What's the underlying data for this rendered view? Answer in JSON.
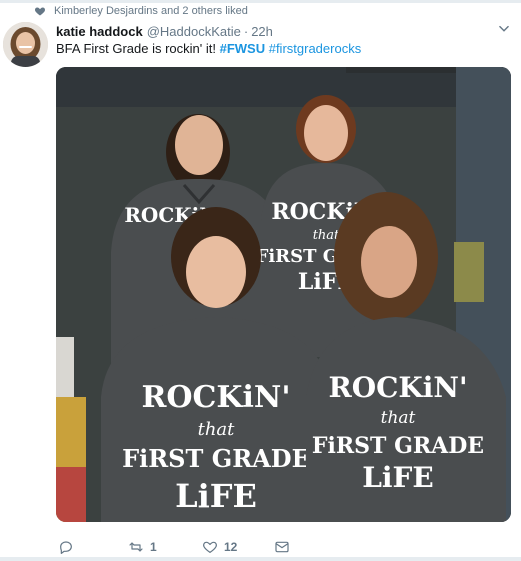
{
  "liked_banner": {
    "text": "Kimberley Desjardins and 2 others liked"
  },
  "tweet": {
    "author_name": "katie haddock",
    "author_handle": "@HaddockKatie",
    "separator": "·",
    "time": "22h",
    "text_plain": "BFA First Grade is rockin' it! ",
    "hashtag_1": "#FWSU",
    "hashtag_2": "#firstgraderocks"
  },
  "photo": {
    "shirt_line_1": "ROCKiN'",
    "shirt_line_2": "that",
    "shirt_line_3": "FiRST GRADE",
    "shirt_line_4": "LiFE"
  },
  "actions": {
    "reply_count": "",
    "retweet_count": "1",
    "like_count": "12"
  },
  "colors": {
    "link": "#1b95e0",
    "muted": "#657786",
    "shirt": "#4a4d4f",
    "wall": "#3b4140"
  }
}
